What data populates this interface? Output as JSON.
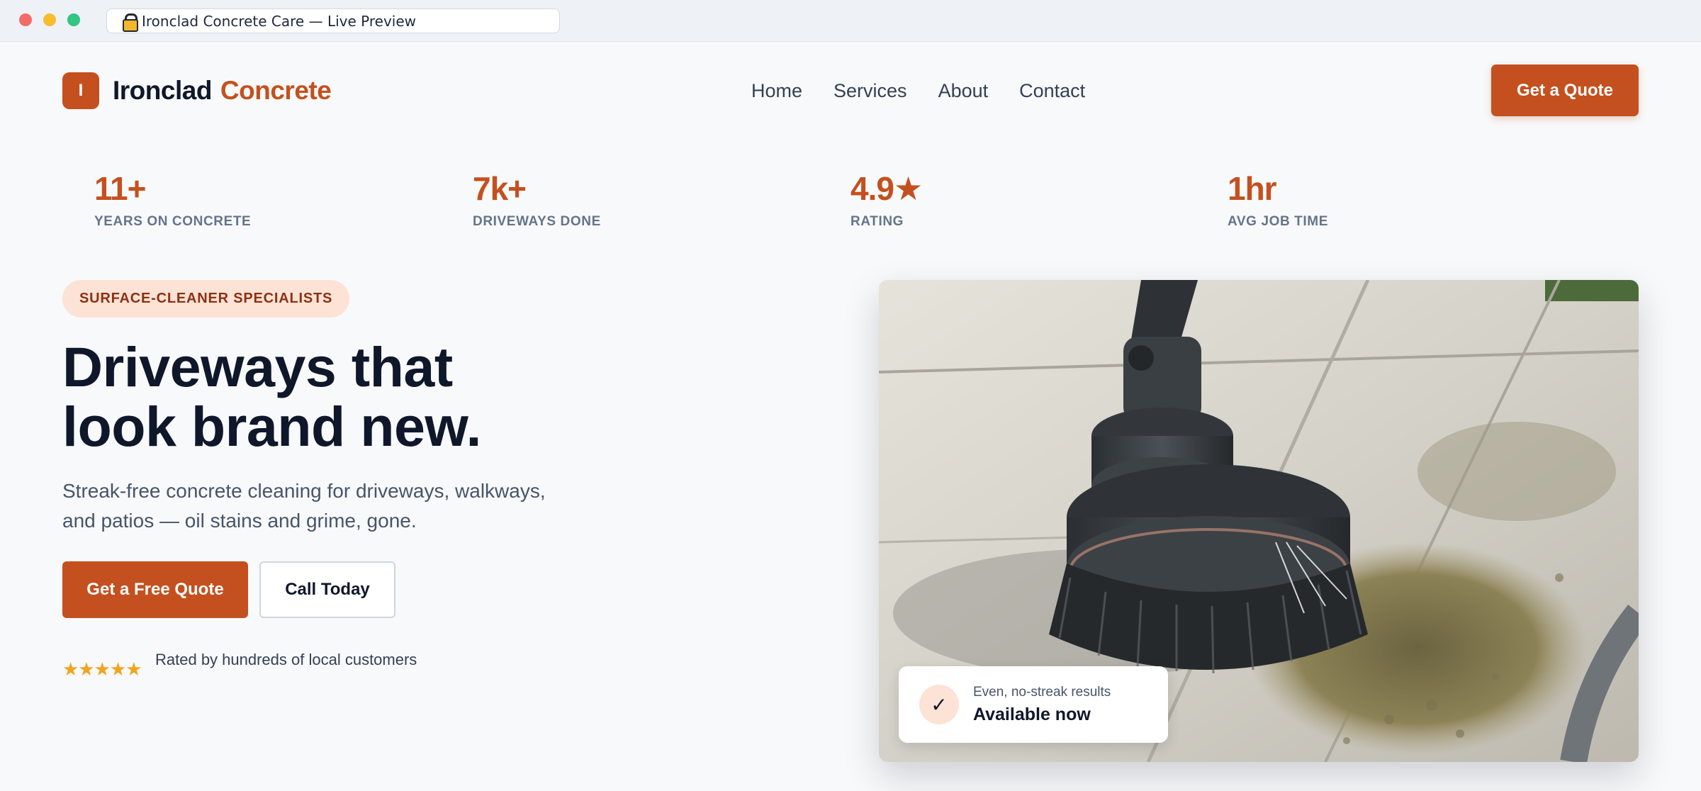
{
  "browser": {
    "title": "Ironclad Concrete Care — Live Preview",
    "lock_icon": "lock-icon"
  },
  "header": {
    "logo_letter": "I",
    "logo_word1": "Ironclad",
    "logo_word2": "Concrete",
    "nav": [
      "Home",
      "Services",
      "About",
      "Contact"
    ],
    "cta": "Get a Quote"
  },
  "stats": [
    {
      "value": "11+",
      "label": "YEARS ON CONCRETE"
    },
    {
      "value": "7k+",
      "label": "DRIVEWAYS DONE"
    },
    {
      "value": "4.9★",
      "label": "RATING"
    },
    {
      "value": "1hr",
      "label": "AVG JOB TIME"
    }
  ],
  "hero": {
    "pill": "SURFACE-CLEANER SPECIALISTS",
    "headline_line1": "Driveways that",
    "headline_line2": "look brand new.",
    "sub_line1": "Streak-free concrete cleaning for driveways, walkways,",
    "sub_line2": "and patios — oil stains and grime, gone.",
    "primary_button": "Get a Free Quote",
    "secondary_button": "Call Today",
    "stars": "★★★★★",
    "rated_text": "Rated by hundreds of local customers"
  },
  "image_badge": {
    "check": "✓",
    "line1": "Even, no-streak results",
    "line2": "Available now"
  },
  "colors": {
    "accent": "#c4501f",
    "accent_soft": "#fde2d6",
    "text_dark": "#0f172a",
    "text_muted": "#64748b",
    "star": "#f0a41f"
  }
}
